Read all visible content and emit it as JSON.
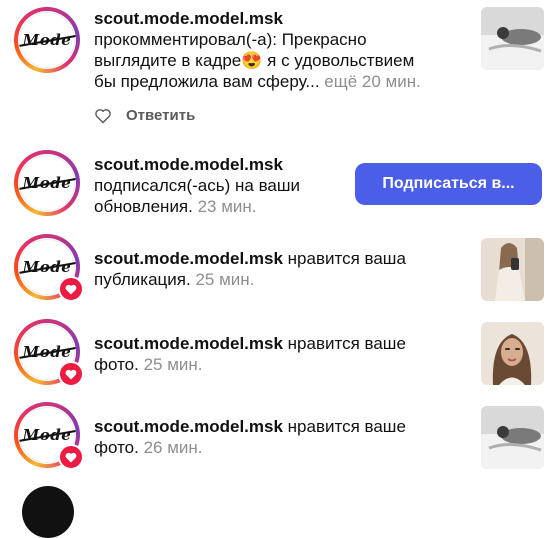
{
  "notifications": [
    {
      "username": "scout.mode.model.msk",
      "action_line1": "прокомментировал(-а): Прекрасно",
      "action_line2a": "выглядите в кадре",
      "emoji": "😍",
      "action_line2b": " я с удовольствием",
      "action_line3": "бы предложила вам сферу...",
      "more": " ещё",
      "time": " 20 мин.",
      "reply_label": "Ответить",
      "thumb_icon": "photo-thumbnail-bed"
    },
    {
      "username": "scout.mode.model.msk",
      "action_line1": "подписался(-ась) на ваши",
      "action_line2": "обновления.",
      "time": " 23 мин.",
      "follow_label": "Подписаться в..."
    },
    {
      "username": "scout.mode.model.msk",
      "action_inline": " нравится ваша",
      "action_line2": "публикация.",
      "time": " 25 мин.",
      "thumb_icon": "photo-thumbnail-mirror-selfie"
    },
    {
      "username": "scout.mode.model.msk",
      "action_inline": " нравится ваше",
      "action_line2": "фото.",
      "time": " 25 мин.",
      "thumb_icon": "photo-thumbnail-portrait"
    },
    {
      "username": "scout.mode.model.msk",
      "action_inline": " нравится ваше",
      "action_line2": "фото.",
      "time": " 26 мин.",
      "thumb_icon": "photo-thumbnail-bed"
    }
  ],
  "avatar_logo_text": "Mode",
  "colors": {
    "accent_button": "#4a5ee8",
    "heart_badge": "#ed1b41",
    "muted_text": "#8e8e8e"
  }
}
